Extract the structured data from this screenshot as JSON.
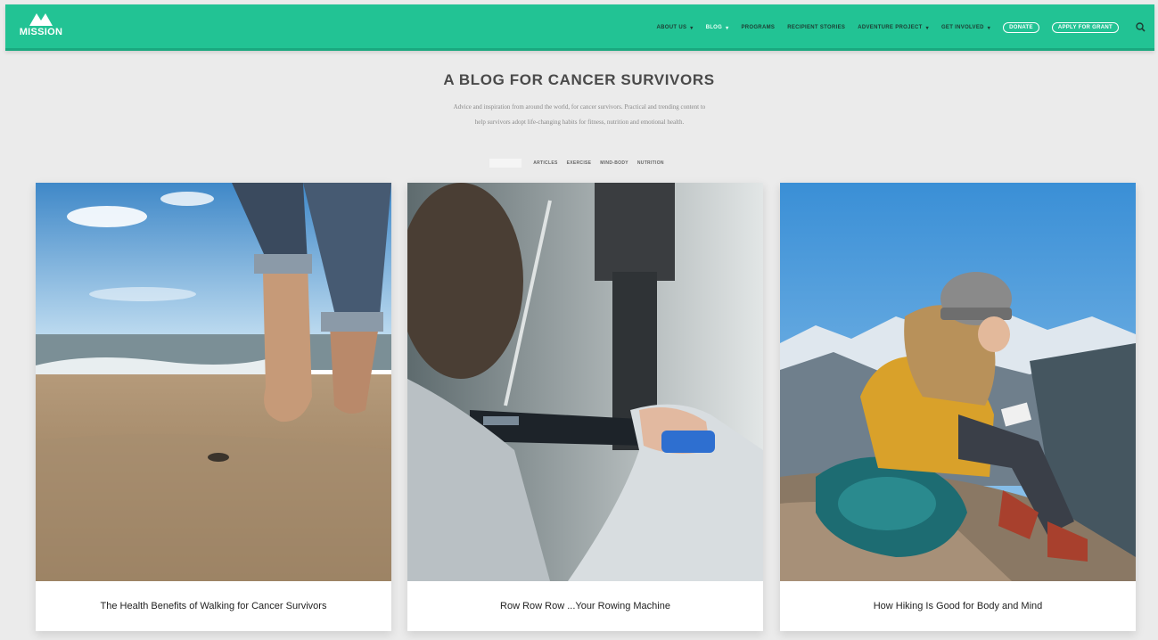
{
  "brand": {
    "name": "MISSION"
  },
  "nav": {
    "items": [
      {
        "label": "ABOUT US",
        "dropdown": true,
        "active": false
      },
      {
        "label": "BLOG",
        "dropdown": true,
        "active": true
      },
      {
        "label": "PROGRAMS",
        "dropdown": false,
        "active": false
      },
      {
        "label": "RECIPIENT STORIES",
        "dropdown": false,
        "active": false
      },
      {
        "label": "ADVENTURE PROJECT",
        "dropdown": true,
        "active": false
      },
      {
        "label": "GET INVOLVED",
        "dropdown": true,
        "active": false
      }
    ],
    "donate_label": "DONATE",
    "apply_label": "APPLY FOR GRANT"
  },
  "hero": {
    "title": "A BLOG FOR CANCER SURVIVORS",
    "subtitle_line1": "Advice and inspiration from around the world, for cancer survivors. Practical and trending content to",
    "subtitle_line2": "help survivors adopt life-changing habits for fitness, nutrition and emotional health."
  },
  "filters": [
    "ARTICLES",
    "EXERCISE",
    "MIND-BODY",
    "NUTRITION"
  ],
  "cards": [
    {
      "title": "The Health Benefits of Walking for Cancer Survivors",
      "image": "barefoot-beach-walk"
    },
    {
      "title": "Row Row Row ...Your Rowing Machine",
      "image": "rowing-machine"
    },
    {
      "title": "How Hiking Is Good for Body and Mind",
      "image": "hiker-mountain-journal"
    }
  ],
  "colors": {
    "header_bg": "#22c394",
    "page_bg": "#ebebeb"
  },
  "icons": {
    "logo": "mountain-logo-icon",
    "search": "search-icon",
    "caret": "caret-down-icon"
  }
}
